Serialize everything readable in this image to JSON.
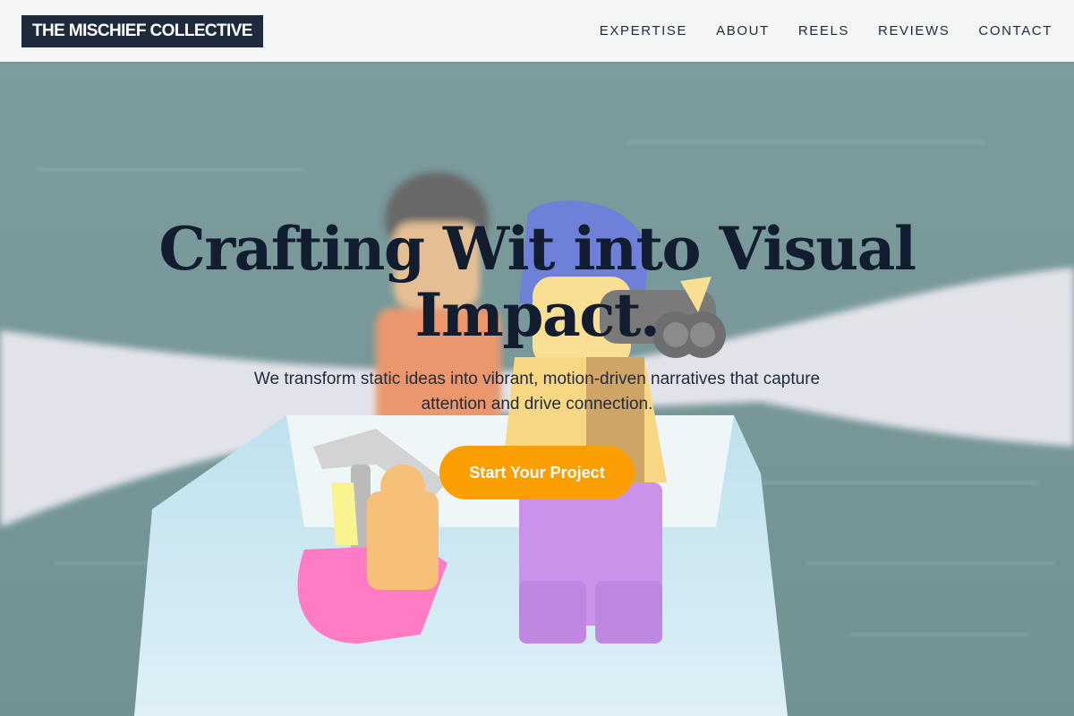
{
  "header": {
    "logo": "THE MISCHIEF COLLECTIVE",
    "nav": [
      "EXPERTISE",
      "ABOUT",
      "REELS",
      "REVIEWS",
      "CONTACT"
    ]
  },
  "hero": {
    "headline": "Crafting Wit into Visual Impact.",
    "subtext": "We transform static ideas into vibrant, motion-driven narratives that capture attention and drive connection.",
    "cta_label": "Start Your Project",
    "background_image": "lego-minifigures-in-paper-boat"
  },
  "colors": {
    "brand_dark": "#1f2b3d",
    "accent": "#fb9e00",
    "header_bg": "#f4f5f5"
  }
}
